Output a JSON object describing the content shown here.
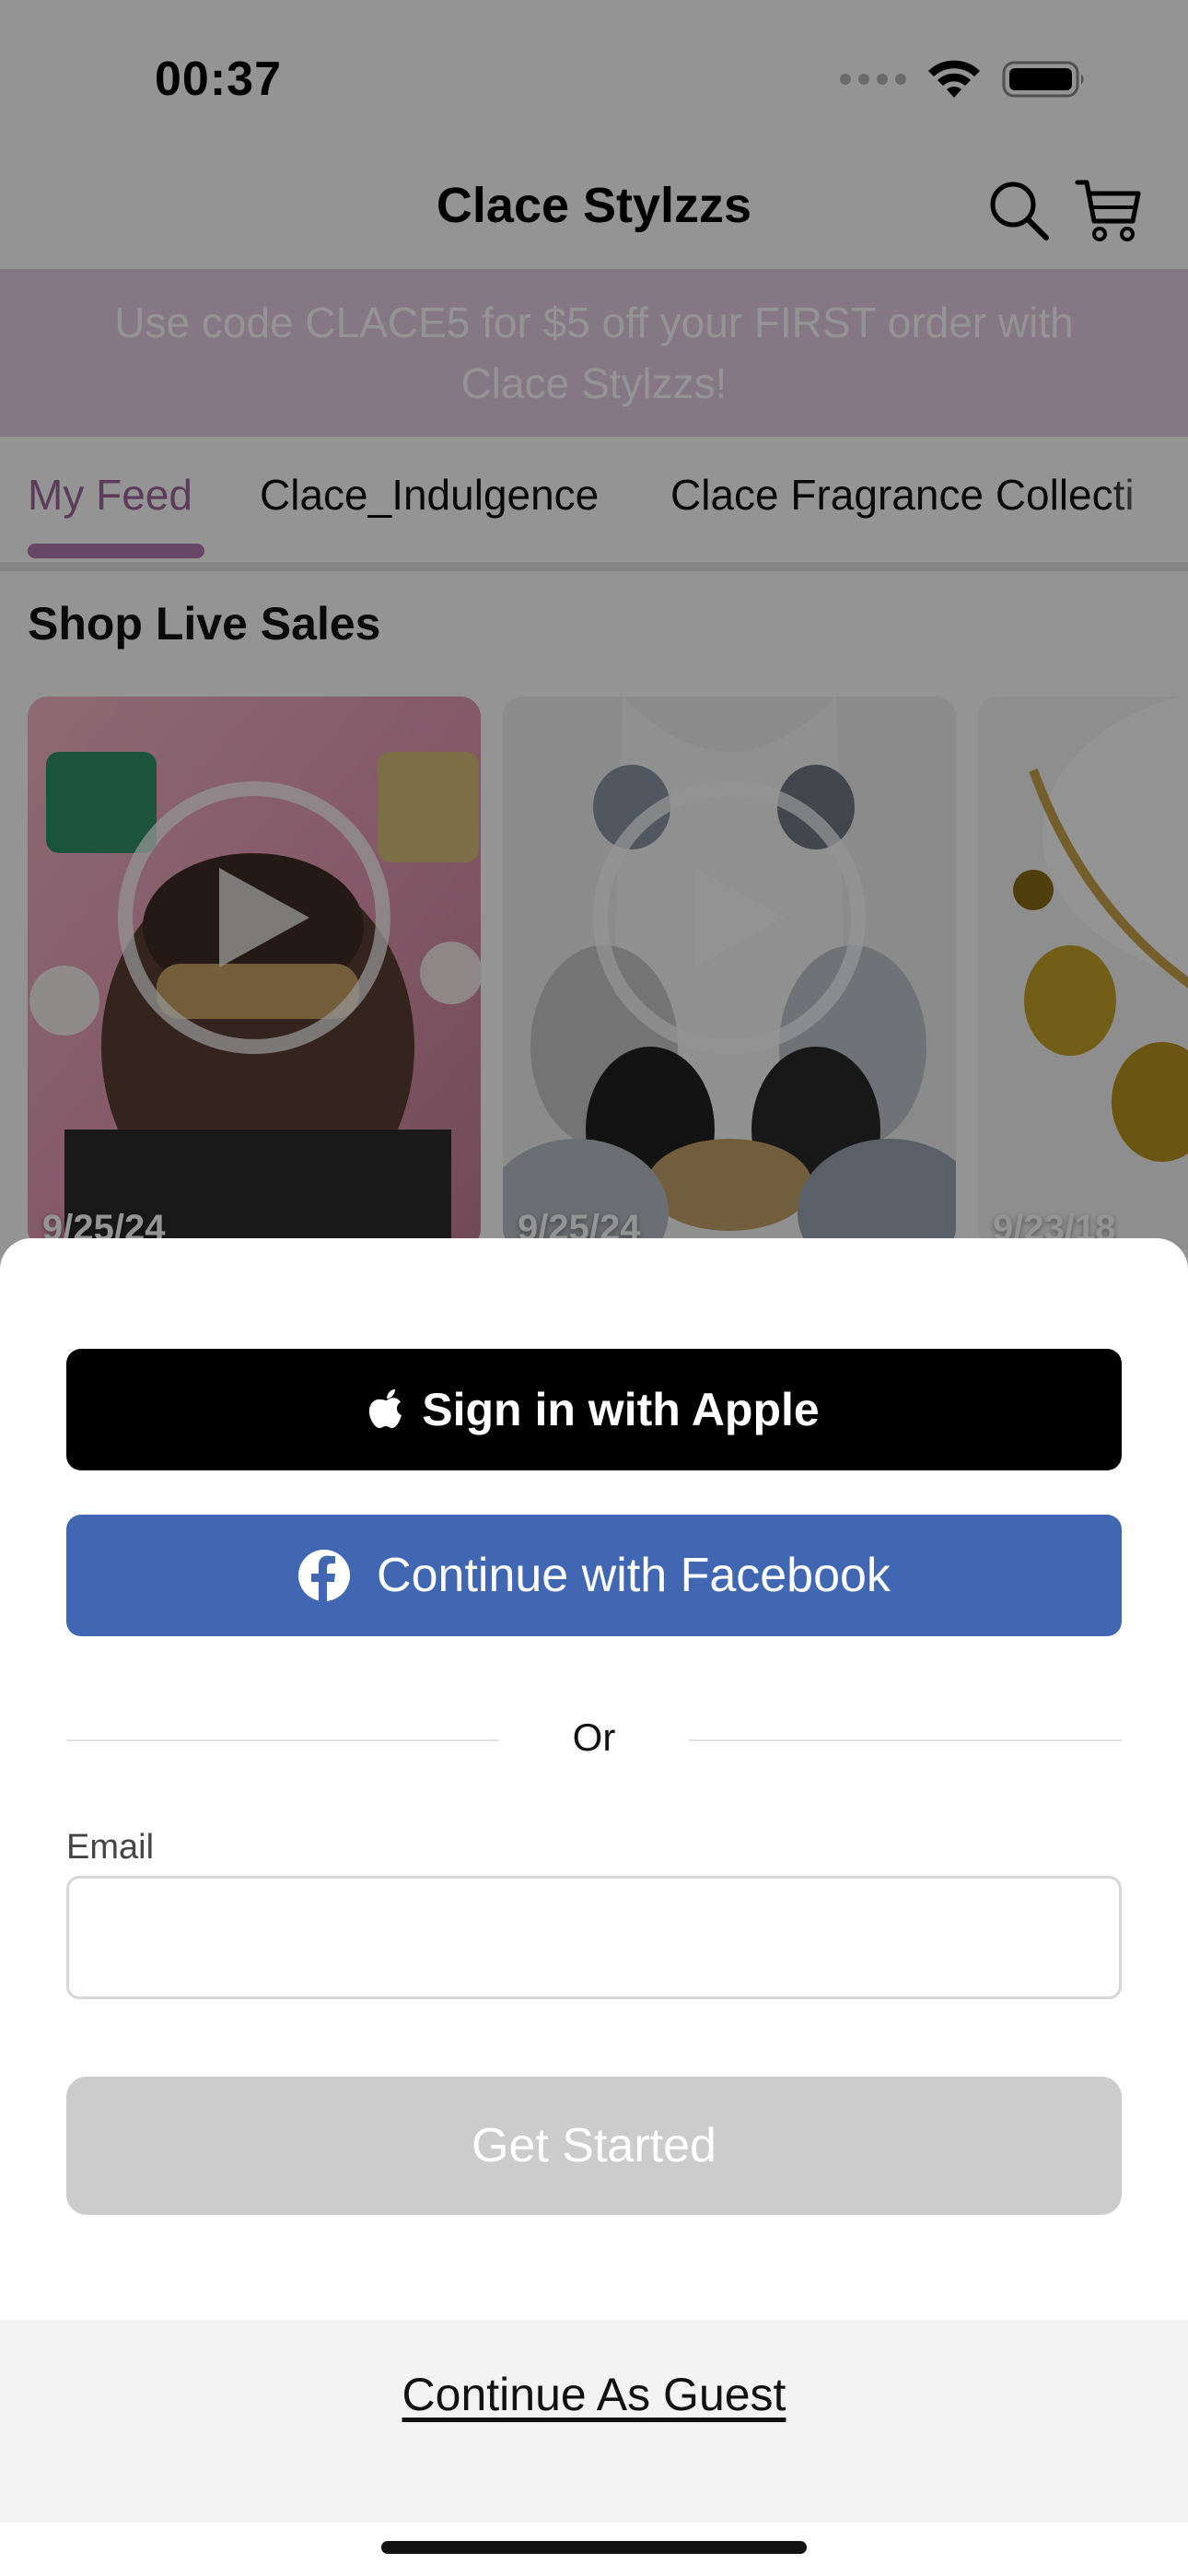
{
  "status_bar": {
    "time": "00:37",
    "icons": [
      "signal-dots-icon",
      "wifi-icon",
      "battery-icon"
    ]
  },
  "header": {
    "title": "Clace Stylzzs",
    "icons": [
      "search-icon",
      "cart-icon"
    ]
  },
  "promo": {
    "text": "Use code CLACE5 for $5 off your FIRST order with Clace Stylzzs!"
  },
  "tabs": [
    {
      "label": "My Feed",
      "active": true
    },
    {
      "label": "Clace_Indulgence",
      "active": false
    },
    {
      "label": "Clace Fragrance Collecti",
      "active": false
    }
  ],
  "live_sales": {
    "title": "Shop Live Sales",
    "cards": [
      {
        "date": "9/25/24",
        "has_play": true
      },
      {
        "date": "9/25/24",
        "has_play": true
      },
      {
        "date": "9/23/18",
        "has_play": false
      }
    ]
  },
  "auth_sheet": {
    "apple_label": "Sign in with Apple",
    "facebook_label": "Continue with Facebook",
    "or_label": "Or",
    "email_label": "Email",
    "email_value": "",
    "email_placeholder": "",
    "get_started_label": "Get Started",
    "guest_label": "Continue As Guest"
  },
  "colors": {
    "accent": "#b479ae",
    "promo_bg": "#e6cde3",
    "facebook": "#4267b2",
    "apple": "#000000",
    "disabled_button": "#cccccc"
  }
}
